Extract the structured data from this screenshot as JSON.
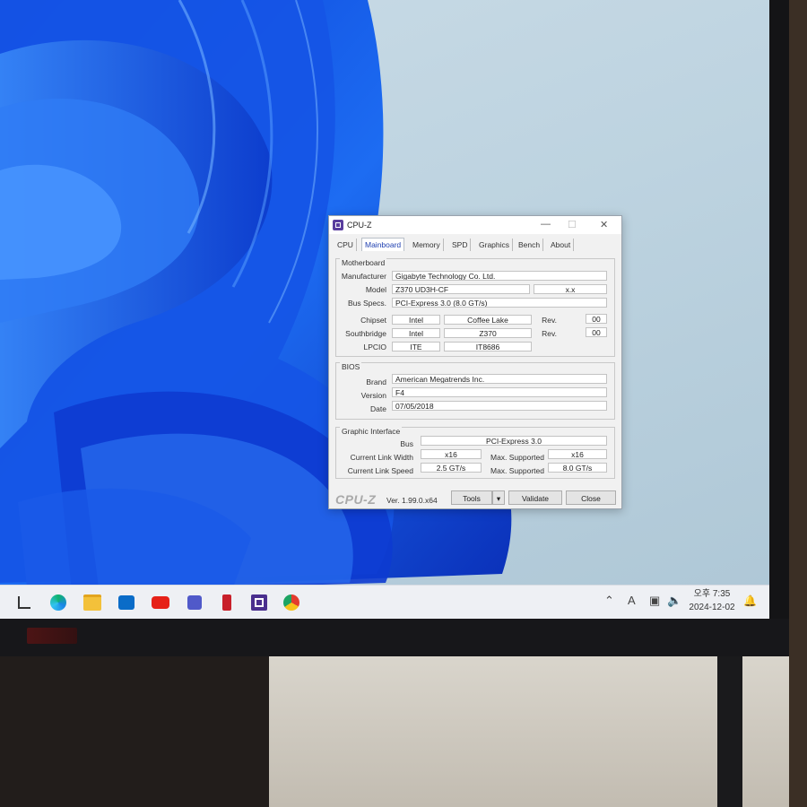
{
  "window": {
    "title": "CPU-Z",
    "tabs": [
      "CPU",
      "Mainboard",
      "Memory",
      "SPD",
      "Graphics",
      "Bench",
      "About"
    ],
    "active_tab": "Mainboard"
  },
  "motherboard": {
    "title": "Motherboard",
    "manufacturer_label": "Manufacturer",
    "manufacturer": "Gigabyte Technology Co. Ltd.",
    "model_label": "Model",
    "model": "Z370 UD3H-CF",
    "model_rev": "x.x",
    "busspecs_label": "Bus Specs.",
    "busspecs": "PCI-Express 3.0 (8.0 GT/s)",
    "chipset_label": "Chipset",
    "chipset_vendor": "Intel",
    "chipset_name": "Coffee Lake",
    "rev_label": "Rev.",
    "chipset_rev": "00",
    "southbridge_label": "Southbridge",
    "southbridge_vendor": "Intel",
    "southbridge_name": "Z370",
    "southbridge_rev": "00",
    "lpcio_label": "LPCIO",
    "lpcio_vendor": "ITE",
    "lpcio_name": "IT8686"
  },
  "bios": {
    "title": "BIOS",
    "brand_label": "Brand",
    "brand": "American Megatrends Inc.",
    "version_label": "Version",
    "version": "F4",
    "date_label": "Date",
    "date": "07/05/2018"
  },
  "graphic": {
    "title": "Graphic Interface",
    "bus_label": "Bus",
    "bus": "PCI-Express 3.0",
    "width_label": "Current Link Width",
    "width": "x16",
    "max_label": "Max. Supported",
    "max_width": "x16",
    "speed_label": "Current Link Speed",
    "speed": "2.5 GT/s",
    "max_speed": "8.0 GT/s"
  },
  "footer": {
    "logo": "CPU-Z",
    "version": "Ver. 1.99.0.x64",
    "tools": "Tools",
    "validate": "Validate",
    "close": "Close"
  },
  "taskbar": {
    "ime": "A",
    "time": "오후 7:35",
    "date": "2024-12-02"
  }
}
